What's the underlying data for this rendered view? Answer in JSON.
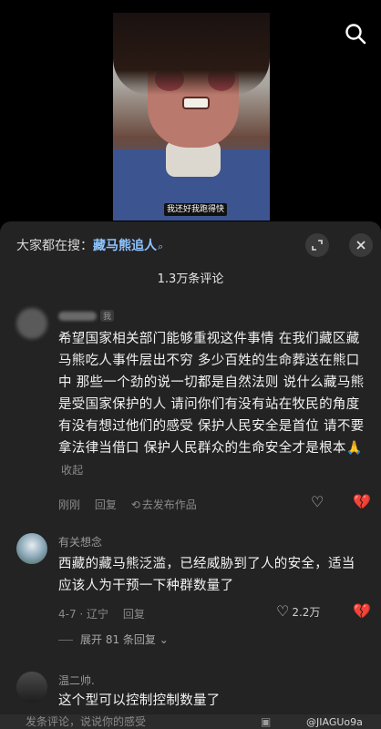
{
  "video": {
    "caption": "我还好我跑得快"
  },
  "header": {
    "prefix": "大家都在搜：",
    "keyword": "藏马熊追人",
    "keyword_icon": "search-icon",
    "expand_icon": "fullscreen-icon",
    "close_icon": "close-icon"
  },
  "comment_count": "1.3万条评论",
  "comments": [
    {
      "badge": "我",
      "text": "希望国家相关部门能够重视这件事情 在我们藏区藏马熊吃人事件层出不穷 多少百姓的生命葬送在熊口中 那些一个劲的说一切都是自然法则 说什么藏马熊是受国家保护的人 请问你们有没有站在牧民的角度 有没有想过他们的感受  保护人民安全是首位 请不要拿法律当借口 保护人民群众的生命安全才是根本",
      "emoji": "🙏",
      "collapse": "收起",
      "time": "刚刚",
      "reply": "回复",
      "share": "去发布作品"
    },
    {
      "user": "有关想念",
      "text": "西藏的藏马熊泛滥，已经威胁到了人的安全，适当应该人为干预一下种群数量了",
      "time": "4-7 · 辽宁",
      "reply": "回复",
      "likes": "2.2万",
      "expand": "展开 81 条回复"
    },
    {
      "user": "温二帅.",
      "text": "这个型可以控制控制数量了"
    }
  ],
  "input": {
    "placeholder": "发条评论，说说你的感受"
  },
  "watermark": "@JIAGUo9a",
  "colors": {
    "keyword": "#8ec4ff",
    "sheet_bg": "#232323"
  }
}
